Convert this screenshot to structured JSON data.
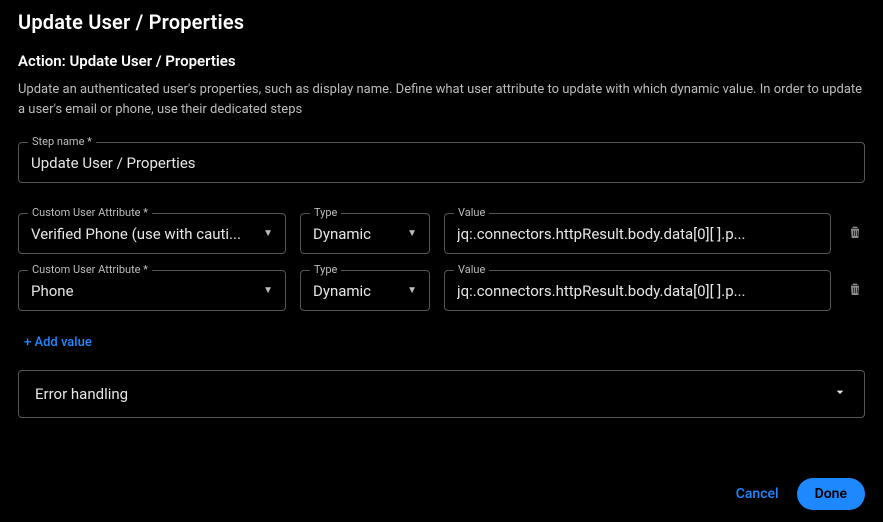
{
  "header": {
    "title": "Update User / Properties",
    "subtitle": "Action: Update User / Properties",
    "description": "Update an authenticated user's properties, such as display name. Define what user attribute to update with which dynamic value. In order to update a user's email or phone, use their dedicated steps"
  },
  "step_name": {
    "label": "Step name *",
    "value": "Update User / Properties"
  },
  "rows": [
    {
      "attr_label": "Custom User Attribute *",
      "attr_value": "Verified Phone (use with cauti...",
      "type_label": "Type",
      "type_value": "Dynamic",
      "val_label": "Value",
      "val_value": "jq:.connectors.httpResult.body.data[0][ ].p..."
    },
    {
      "attr_label": "Custom User Attribute *",
      "attr_value": "Phone",
      "type_label": "Type",
      "type_value": "Dynamic",
      "val_label": "Value",
      "val_value": "jq:.connectors.httpResult.body.data[0][ ].p..."
    }
  ],
  "add_link": "+ Add value",
  "accordion": {
    "title": "Error handling"
  },
  "footer": {
    "cancel": "Cancel",
    "done": "Done"
  }
}
